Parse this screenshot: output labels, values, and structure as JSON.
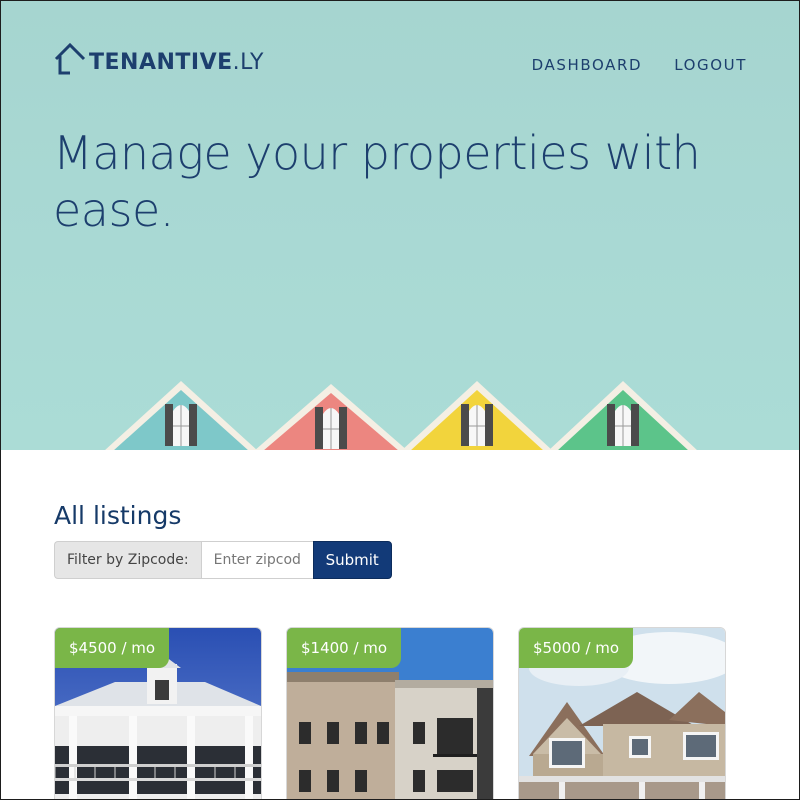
{
  "brand": {
    "name_bold": "TENANTIVE",
    "name_suffix": ".LY"
  },
  "nav": {
    "items": [
      {
        "label": "DASHBOARD"
      },
      {
        "label": "LOGOUT"
      }
    ]
  },
  "hero": {
    "headline": "Manage your properties with ease."
  },
  "listings": {
    "title": "All listings",
    "filter": {
      "label": "Filter by Zipcode:",
      "placeholder": "Enter zipcod",
      "submit": "Submit"
    },
    "cards": [
      {
        "price": "$4500 / mo"
      },
      {
        "price": "$1400 / mo"
      },
      {
        "price": "$5000 / mo"
      }
    ]
  },
  "colors": {
    "navy": "#1d3f6e",
    "accent_green": "#7ab648",
    "hero_bg": "#a9d9d4",
    "button": "#123a78"
  }
}
